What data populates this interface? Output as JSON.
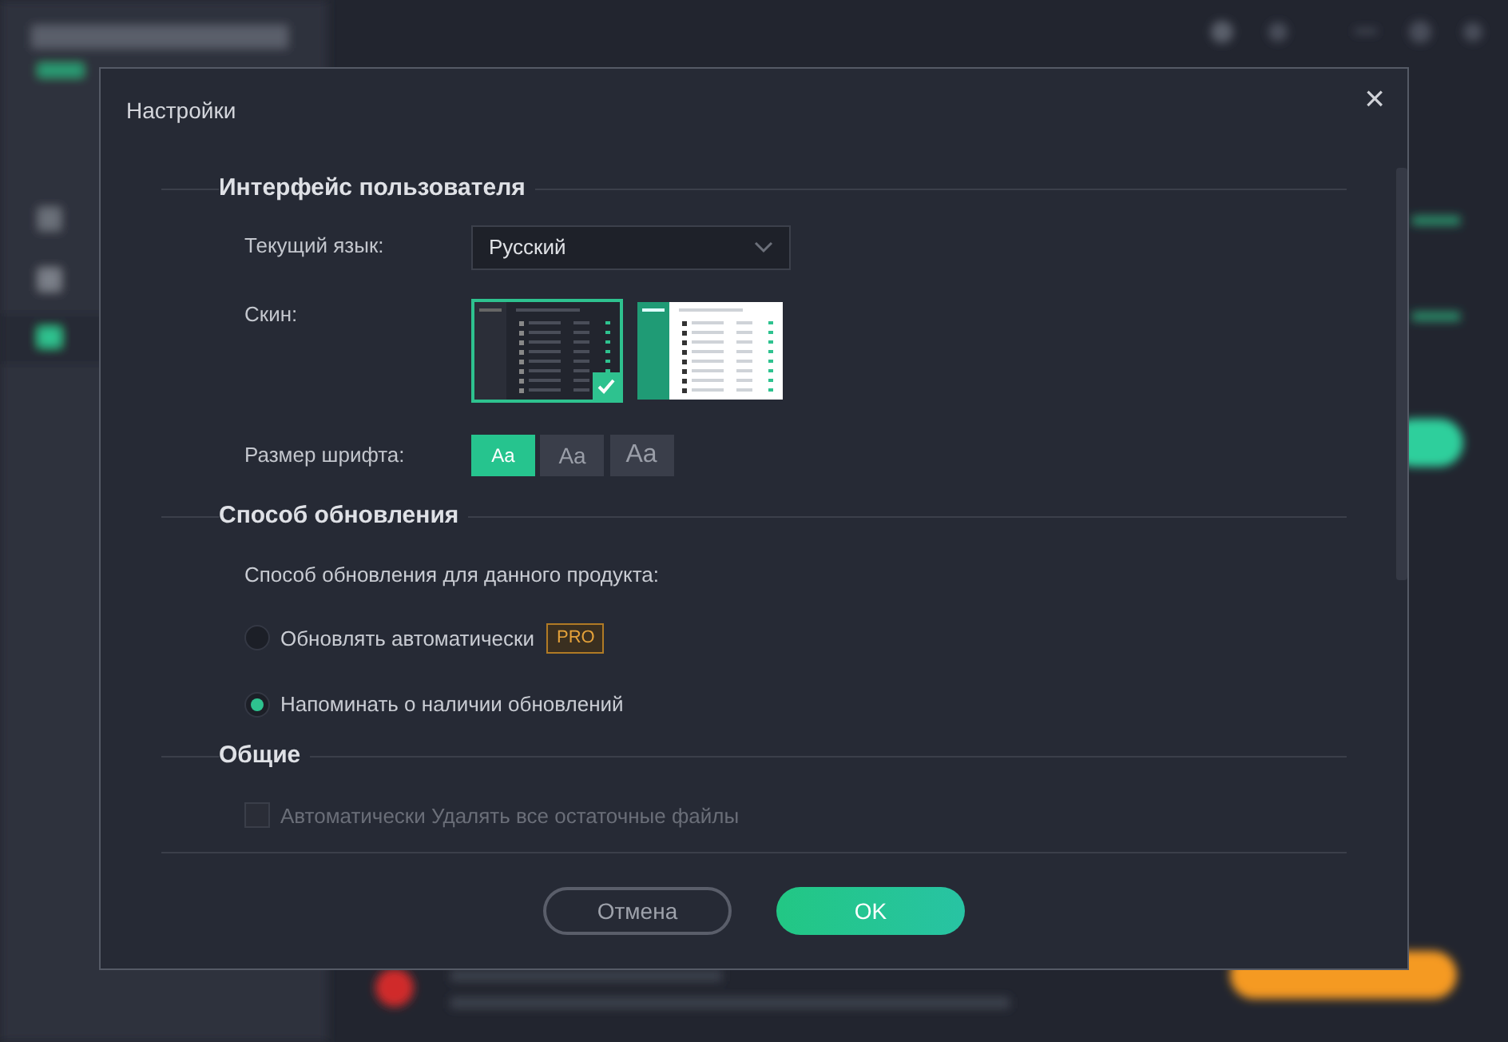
{
  "dialog": {
    "title": "Настройки",
    "close": "×"
  },
  "sections": [
    {
      "title": "Интерфейс пользователя",
      "language": {
        "label": "Текущий язык:",
        "value": "Русский"
      },
      "skin": {
        "label": "Скин:",
        "options": [
          {
            "kind": "dark",
            "selected": true
          },
          {
            "kind": "light",
            "selected": false
          }
        ]
      },
      "font_size": {
        "label": "Размер шрифта:",
        "options": [
          {
            "label": "Aa",
            "selected": true
          },
          {
            "label": "Aa",
            "selected": false
          },
          {
            "label": "Aa",
            "selected": false
          }
        ]
      }
    },
    {
      "title": "Способ обновления",
      "prompt": "Способ обновления для данного продукта:",
      "options": [
        {
          "label": "Обновлять автоматически",
          "badge": "PRO",
          "selected": false
        },
        {
          "label": "Напоминать о наличии обновлений",
          "selected": true
        }
      ]
    },
    {
      "title": "Общие",
      "checkboxes": [
        {
          "label": "Автоматически Удалять все остаточные файлы",
          "checked": false
        }
      ]
    }
  ],
  "buttons": [
    {
      "label": "Отмена",
      "kind": "secondary"
    },
    {
      "label": "OK",
      "kind": "primary"
    }
  ]
}
